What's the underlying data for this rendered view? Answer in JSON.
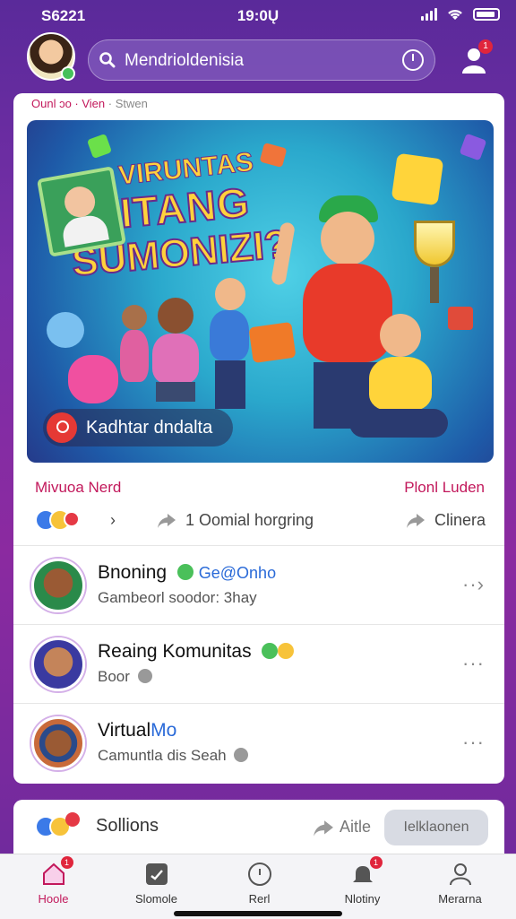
{
  "status": {
    "left": "S6221",
    "time": "19:0Ų"
  },
  "search": {
    "text": "Mendrioldenisia"
  },
  "notifications": {
    "count": "1"
  },
  "breadcrumb": {
    "part1": "Ounl ɔo · Vien",
    "part2": " · Stwen"
  },
  "hero": {
    "title_line1": "VIRUNTAS",
    "title_line2": "KITANG",
    "title_line3": "SUMONIZI?",
    "chip_label": "Kadhtar dndalta"
  },
  "section": {
    "left": "Mivuoa Nerd",
    "right": "Plonl Luden"
  },
  "actions": {
    "comment": "1 Oomial horgring",
    "share": "Clinera"
  },
  "list": [
    {
      "name": "Bnoning",
      "tag": "Ge@Onho",
      "sub": "Gambeorl soodor: 3hay"
    },
    {
      "name": "Reaing Komunitas",
      "tag": "",
      "sub": "Boor"
    },
    {
      "name": "Virtual",
      "tag": "Mo",
      "sub": "Camuntla dis Seah"
    }
  ],
  "bottom": {
    "text": "Sollions",
    "share": "Aitle",
    "button": "Ielklaonen"
  },
  "tabs": [
    {
      "label": "Hoole",
      "active": true,
      "badge": "1"
    },
    {
      "label": "Slomole",
      "active": false
    },
    {
      "label": "Rerl",
      "active": false
    },
    {
      "label": "Nlotiny",
      "active": false,
      "badge": "1"
    },
    {
      "label": "Merarna",
      "active": false
    }
  ],
  "colors": {
    "accent": "#c2185b",
    "brand_purple": "#7a2fa8",
    "badge_red": "#e0253c"
  }
}
